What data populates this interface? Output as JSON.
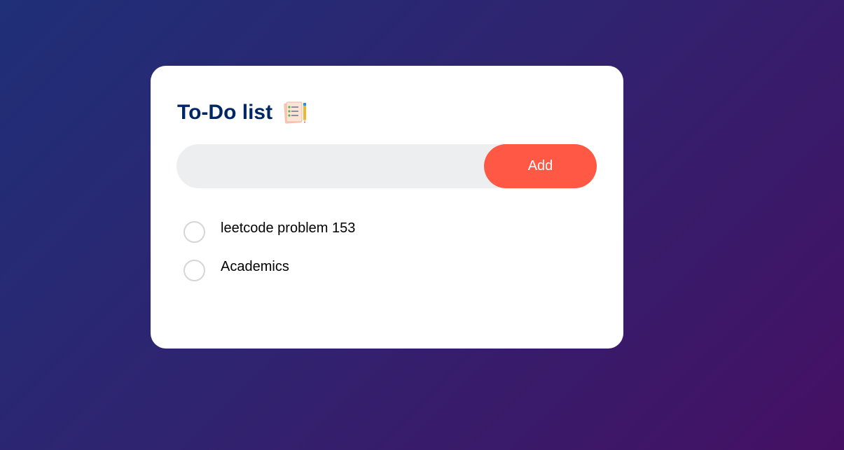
{
  "app": {
    "title": "To-Do list",
    "title_icon": "checklist-notepad-icon"
  },
  "input": {
    "value": "",
    "placeholder": ""
  },
  "add_button": {
    "label": "Add",
    "color": "#ff5945"
  },
  "tasks": [
    {
      "text": "leetcode problem 153",
      "checked": false
    },
    {
      "text": "Academics",
      "checked": false
    }
  ],
  "colors": {
    "title": "#002765",
    "card": "#ffffff",
    "input_bg": "#edeef0",
    "background_start": "#1f2f78",
    "background_end": "#451064"
  }
}
